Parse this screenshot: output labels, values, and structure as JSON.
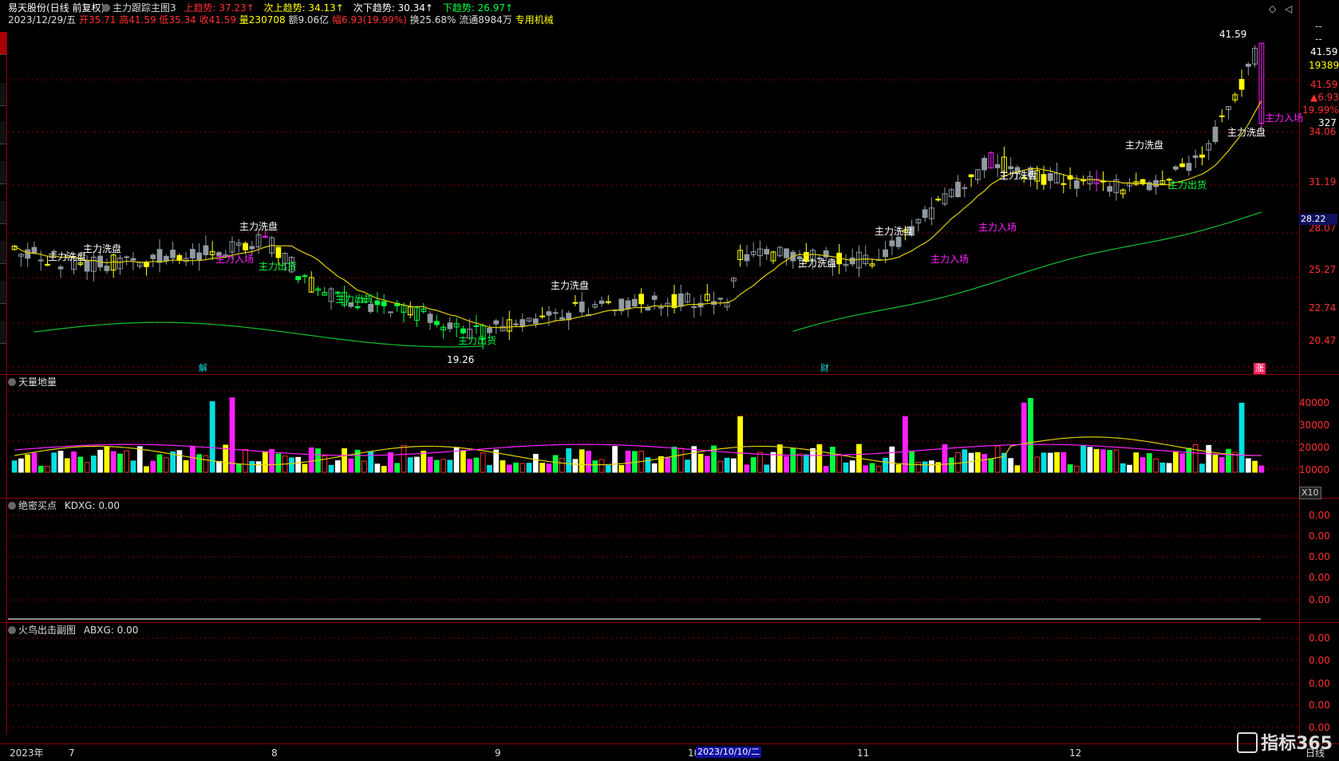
{
  "header": {
    "stock_title": "易天股份(日线 前复权)",
    "indicator_name": "主力跟踪主图3",
    "up_trend": "上趋势: 37.23↑",
    "sub_up_trend": "次上趋势: 34.13↑",
    "sub_down_trend": "次下趋势: 30.34↑",
    "down_trend": "下趋势: 26.97↑",
    "date": "2023/12/29/五",
    "open": "开35.71",
    "high": "高41.59",
    "low": "低35.34",
    "close": "收41.59",
    "volume": "量230708",
    "amount": "额9.06亿",
    "change": "幅6.93(19.99%)",
    "turnover": "换25.68%",
    "float": "流通8984万",
    "sector": "专用机械"
  },
  "price_axis": {
    "labels": [
      "34.06",
      "31.19",
      "28.07",
      "25.27",
      "22.74",
      "20.47"
    ],
    "dash1": "--",
    "dash2": "--",
    "last": "41.59",
    "vol": "19389",
    "last2": "41.59",
    "chg": "▲6.93",
    "pct": "19.99%",
    "num": "327",
    "cursor": "28.22"
  },
  "annotations": {
    "peak": "41.59",
    "low_mark": "19.26",
    "wash": "主力洗盘",
    "enter": "主力入场",
    "exit": "主力出货",
    "tag_jie": "解",
    "tag_cai": "财",
    "tag_zhang": "涨"
  },
  "volume_pane": {
    "title": "天量地量",
    "labels": [
      "40000",
      "30000",
      "20000",
      "10000"
    ],
    "scale": "X10"
  },
  "kd_pane": {
    "title": "绝密买点",
    "value": "KDXG: 0.00",
    "labels": [
      "0.00",
      "0.00",
      "0.00",
      "0.00",
      "0.00"
    ]
  },
  "ab_pane": {
    "title": "火鸟出击副图",
    "value": "ABXG: 0.00",
    "labels": [
      "0.00",
      "0.00",
      "0.00",
      "0.00",
      "0.00",
      "0.00"
    ]
  },
  "footer": {
    "year": "2023年",
    "months": [
      "7",
      "8",
      "9",
      "10",
      "11",
      "12"
    ],
    "cursor_date": "2023/10/10/二",
    "period": "日线",
    "brand": "指标365"
  },
  "colors": {
    "up": "#ff3030",
    "down": "#00e0e0",
    "yellow": "#ffff00",
    "magenta": "#ff20ff",
    "green": "#00ff40",
    "gray": "#909aa0",
    "grid": "#8b0000"
  },
  "chart_data": {
    "type": "candlestick",
    "price_range": [
      19.26,
      41.59
    ],
    "ohlc_recent": {
      "date": "2023/12/29",
      "open": 35.71,
      "high": 41.59,
      "low": 35.34,
      "close": 41.59,
      "volume": 230708
    },
    "volume_range": [
      0,
      46000
    ]
  }
}
